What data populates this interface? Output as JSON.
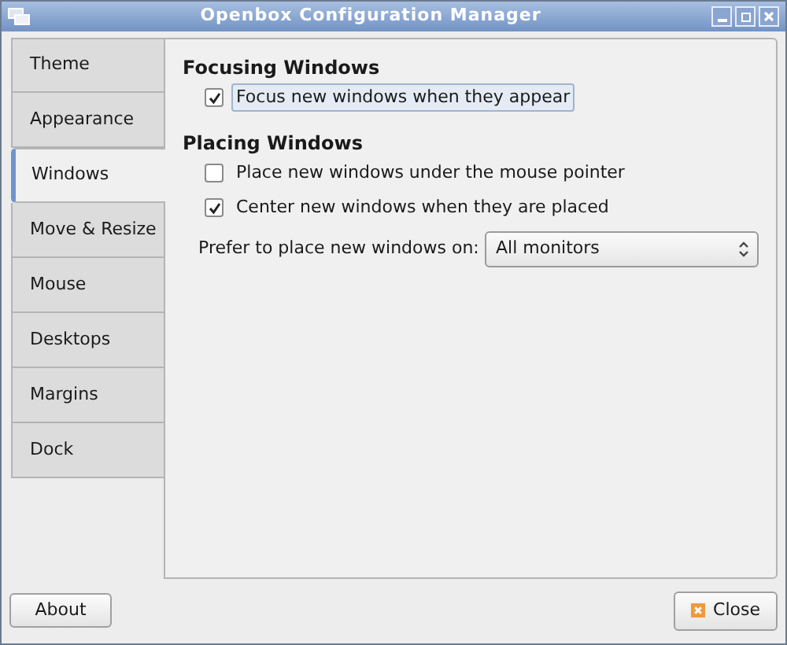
{
  "window": {
    "title": "Openbox Configuration Manager"
  },
  "tabs": [
    {
      "label": "Theme",
      "selected": false
    },
    {
      "label": "Appearance",
      "selected": false
    },
    {
      "label": "Windows",
      "selected": true
    },
    {
      "label": "Move & Resize",
      "selected": false
    },
    {
      "label": "Mouse",
      "selected": false
    },
    {
      "label": "Desktops",
      "selected": false
    },
    {
      "label": "Margins",
      "selected": false
    },
    {
      "label": "Dock",
      "selected": false
    }
  ],
  "sections": [
    {
      "heading": "Focusing Windows",
      "options": [
        {
          "label": "Focus new windows when they appear",
          "checked": true,
          "focused": true
        }
      ]
    },
    {
      "heading": "Placing Windows",
      "options": [
        {
          "label": "Place new windows under the mouse pointer",
          "checked": false,
          "focused": false
        },
        {
          "label": "Center new windows when they are placed",
          "checked": true,
          "focused": false
        }
      ],
      "dropdown": {
        "label": "Prefer to place new windows on:",
        "value": "All monitors"
      }
    }
  ],
  "buttons": [
    {
      "label": "About",
      "kind": "plain"
    },
    {
      "label": "Close",
      "kind": "close"
    }
  ]
}
